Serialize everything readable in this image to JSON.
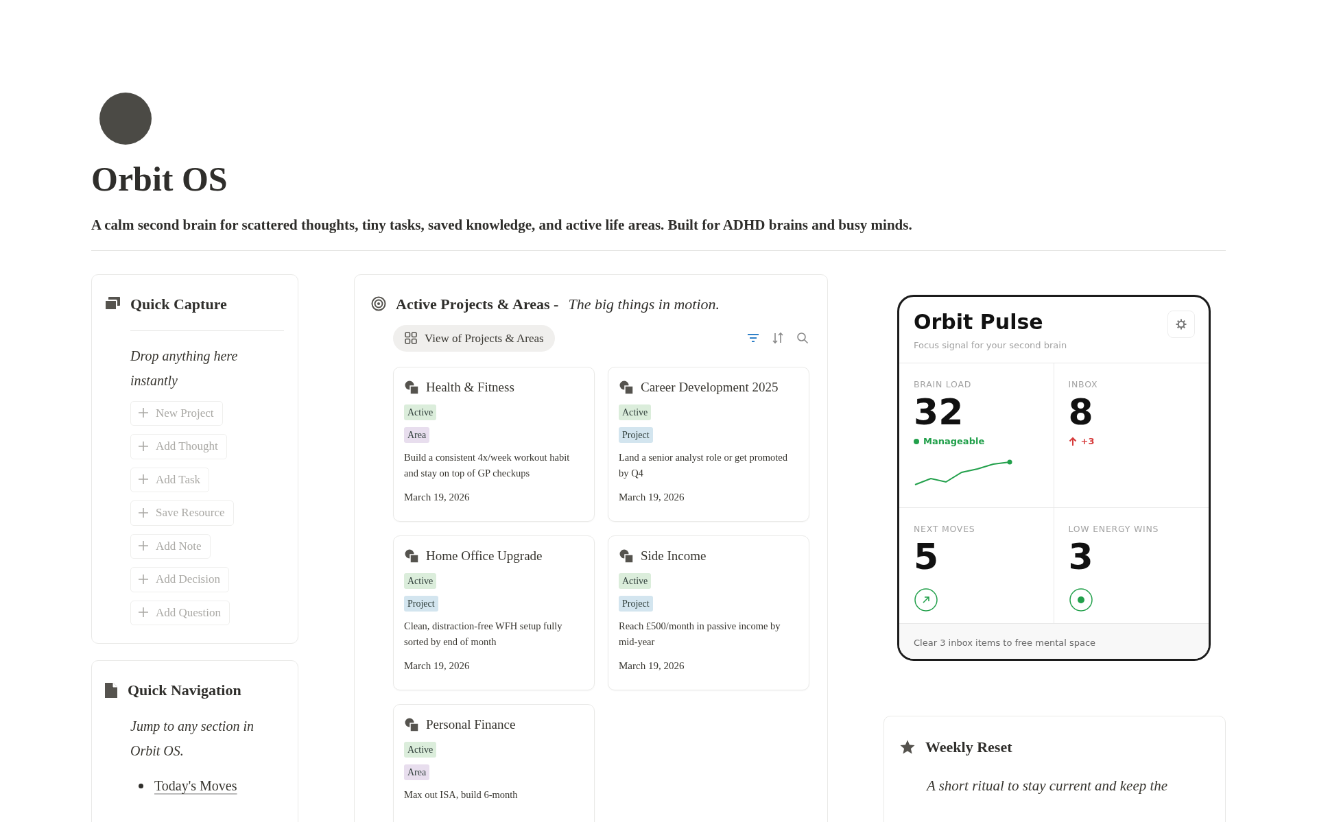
{
  "page": {
    "title": "Orbit OS",
    "description": "A calm second brain for scattered thoughts, tiny tasks, saved knowledge, and active life areas. Built for ADHD brains and busy minds."
  },
  "quick_capture": {
    "title": "Quick Capture",
    "subtitle": "Drop anything here instantly",
    "buttons": [
      "New Project",
      "Add Thought",
      "Add Task",
      "Save Resource",
      "Add Note",
      "Add Decision",
      "Add Question"
    ]
  },
  "quick_navigation": {
    "title": "Quick Navigation",
    "subtitle": "Jump to any section in Orbit OS.",
    "links": [
      "Today's Moves"
    ]
  },
  "projects": {
    "title": "Active Projects & Areas -",
    "tagline": "The big things in motion.",
    "view": "View of Projects & Areas",
    "cards": [
      {
        "name": "Health & Fitness",
        "status": {
          "label": "Active",
          "color": "#dbeddb"
        },
        "type": {
          "label": "Area",
          "color": "#e8deee"
        },
        "description": "Build a consistent 4x/week workout habit and stay on top of GP checkups",
        "date": "March 19, 2026"
      },
      {
        "name": "Career Development 2025",
        "status": {
          "label": "Active",
          "color": "#dbeddb"
        },
        "type": {
          "label": "Project",
          "color": "#d3e5ef"
        },
        "description": "Land a senior analyst role or get promoted by Q4",
        "date": "March 19, 2026"
      },
      {
        "name": "Home Office Upgrade",
        "status": {
          "label": "Active",
          "color": "#dbeddb"
        },
        "type": {
          "label": "Project",
          "color": "#d3e5ef"
        },
        "description": "Clean, distraction-free WFH setup fully sorted by end of month",
        "date": "March 19, 2026"
      },
      {
        "name": "Side Income",
        "status": {
          "label": "Active",
          "color": "#dbeddb"
        },
        "type": {
          "label": "Project",
          "color": "#d3e5ef"
        },
        "description": "Reach £500/month in passive income by mid-year",
        "date": "March 19, 2026"
      },
      {
        "name": "Personal Finance",
        "status": {
          "label": "Active",
          "color": "#dbeddb"
        },
        "type": {
          "label": "Area",
          "color": "#e8deee"
        },
        "description": "Max out ISA, build 6-month"
      }
    ]
  },
  "pulse": {
    "title": "Orbit Pulse",
    "subtitle": "Focus signal for your second brain",
    "metrics": [
      {
        "label": "BRAIN LOAD",
        "value": "32",
        "kind": "trend",
        "note": "Manageable"
      },
      {
        "label": "INBOX",
        "value": "8",
        "kind": "delta",
        "note": "+3"
      },
      {
        "label": "NEXT MOVES",
        "value": "5",
        "kind": "arrow-ring"
      },
      {
        "label": "LOW ENERGY WINS",
        "value": "3",
        "kind": "dot-ring"
      }
    ],
    "footer": "Clear 3 inbox items to free mental space"
  },
  "weekly_reset": {
    "title": "Weekly Reset",
    "subtitle": "A short ritual to stay current and keep the"
  }
}
